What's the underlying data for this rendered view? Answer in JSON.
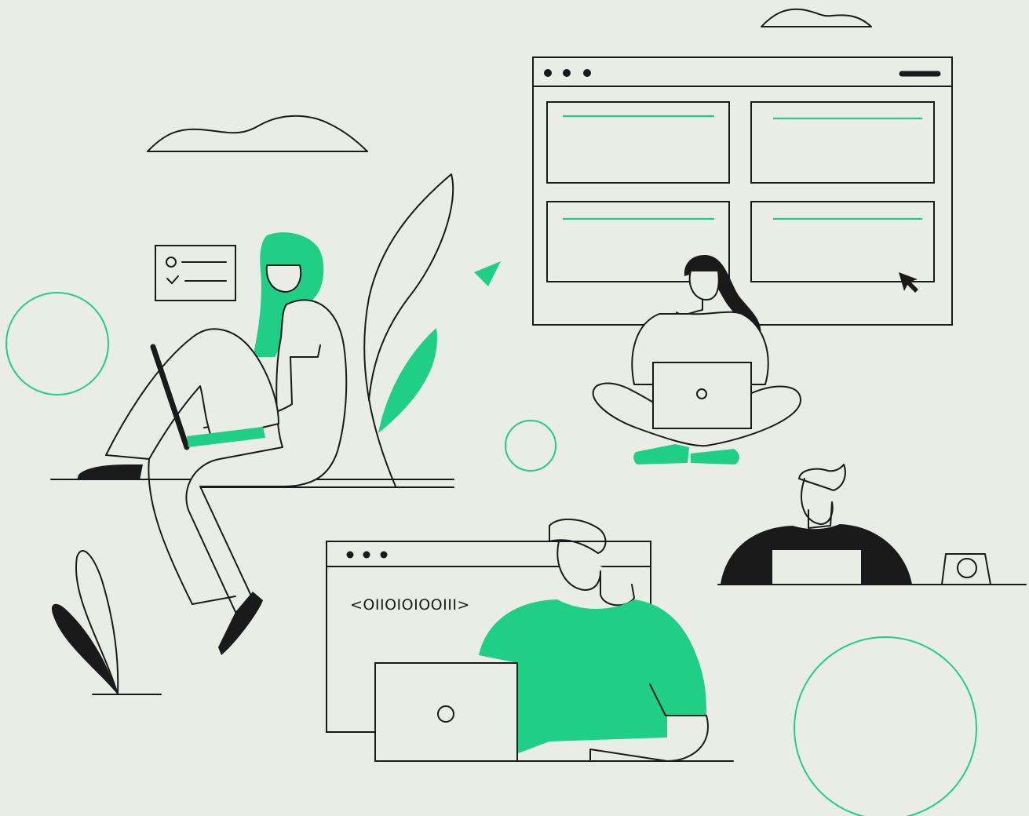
{
  "illustration": {
    "code_snippet": "<OIIOIOIOOIII>",
    "colors": {
      "background": "#eaede6",
      "accent": "#1fcf86",
      "ink": "#1a1a1a"
    }
  }
}
